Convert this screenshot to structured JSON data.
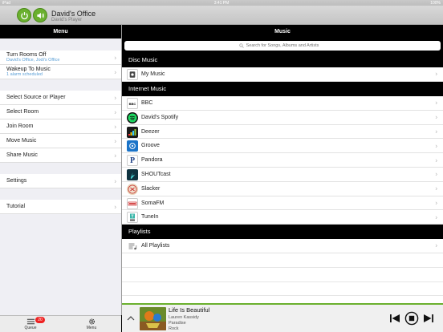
{
  "status_bar": {
    "left": "iPad",
    "time": "3:41 PM",
    "right": "100%"
  },
  "header": {
    "title": "David's Office",
    "subtitle": "David's Player"
  },
  "menu": {
    "title": "Menu",
    "items": [
      {
        "label": "Turn Rooms Off",
        "sub": "David's Office, Jodi's Office"
      },
      {
        "label": "Wakeup To Music",
        "sub": "1 alarm scheduled"
      },
      {
        "label": "Select Source or Player"
      },
      {
        "label": "Select Room"
      },
      {
        "label": "Join Room"
      },
      {
        "label": "Move Music"
      },
      {
        "label": "Share Music"
      },
      {
        "label": "Settings"
      },
      {
        "label": "Tutorial"
      }
    ]
  },
  "music": {
    "title": "Music",
    "search_placeholder": "Search for Songs, Albums and Artists",
    "sections": [
      {
        "title": "Disc Music",
        "items": [
          {
            "label": "My Music",
            "icon": "my-music-icon"
          }
        ]
      },
      {
        "title": "Internet Music",
        "items": [
          {
            "label": "BBC",
            "icon": "bbc-icon"
          },
          {
            "label": "David's Spotify",
            "icon": "spotify-icon"
          },
          {
            "label": "Deezer",
            "icon": "deezer-icon"
          },
          {
            "label": "Groove",
            "icon": "groove-icon"
          },
          {
            "label": "Pandora",
            "icon": "pandora-icon"
          },
          {
            "label": "SHOUTcast",
            "icon": "shoutcast-icon"
          },
          {
            "label": "Slacker",
            "icon": "slacker-icon"
          },
          {
            "label": "SomaFM",
            "icon": "somafm-icon"
          },
          {
            "label": "TuneIn",
            "icon": "tunein-icon"
          }
        ]
      },
      {
        "title": "Playlists",
        "items": [
          {
            "label": "All Playlists",
            "icon": "playlists-icon"
          }
        ]
      }
    ]
  },
  "tabs": {
    "queue_label": "Queue",
    "queue_badge": "20",
    "menu_label": "Menu"
  },
  "now_playing": {
    "title": "Life Is Beautiful",
    "artist": "Lauren Kassidy",
    "album": "Paradise",
    "genre": "Rock"
  },
  "colors": {
    "accent": "#6ab02e",
    "link": "#5a9fd6",
    "badge": "#e22222"
  }
}
